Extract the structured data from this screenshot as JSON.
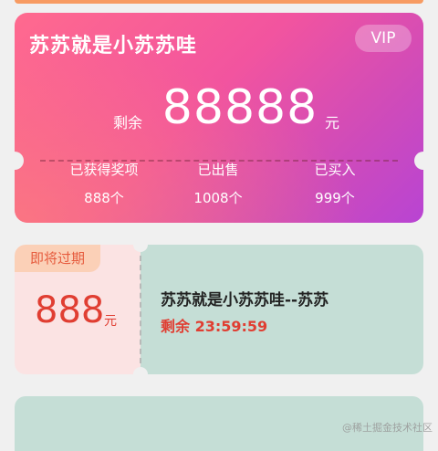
{
  "vip_card": {
    "title": "苏苏就是小苏苏哇",
    "badge": "VIP",
    "remaining_label": "剩余",
    "remaining_amount": "88888",
    "remaining_unit": "元",
    "stats": [
      {
        "label": "已获得奖项",
        "value": "888个"
      },
      {
        "label": "已出售",
        "value": "1008个"
      },
      {
        "label": "已买入",
        "value": "999个"
      }
    ]
  },
  "coupon": {
    "tag": "即将过期",
    "amount": "888",
    "unit": "元",
    "title": "苏苏就是小苏苏哇--苏苏",
    "countdown": "剩余 23:59:59"
  },
  "watermark": "@稀土掘金技术社区",
  "colors": {
    "vip_gradient_start": "#ff6a8e",
    "vip_gradient_end": "#b844d3",
    "coupon_left_bg": "#fbe3e3",
    "coupon_right_bg": "#c5ded6",
    "accent_red": "#e03e32",
    "tag_bg": "#fbd0b7"
  }
}
